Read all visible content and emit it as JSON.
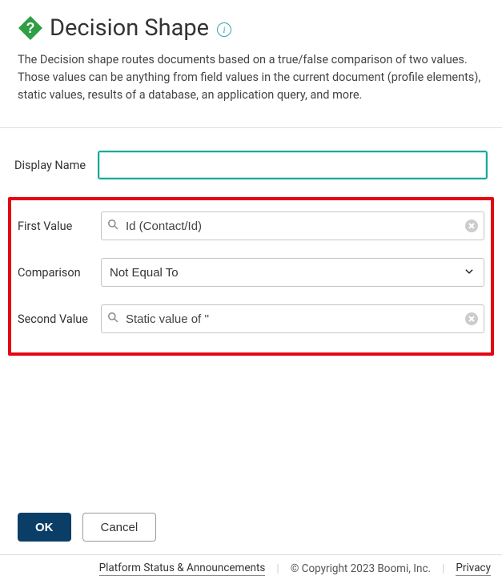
{
  "header": {
    "title": "Decision Shape",
    "description": "The Decision shape routes documents based on a true/false comparison of two values. Those values can be anything from field values in the current document (profile elements), static values, results of a database, an application query, and more."
  },
  "form": {
    "display_name": {
      "label": "Display Name",
      "value": ""
    },
    "first_value": {
      "label": "First Value",
      "value": "Id (Contact/Id)"
    },
    "comparison": {
      "label": "Comparison",
      "value": "Not Equal To"
    },
    "second_value": {
      "label": "Second Value",
      "value": "Static value of ''"
    }
  },
  "buttons": {
    "ok": "OK",
    "cancel": "Cancel"
  },
  "footer": {
    "status_link": "Platform Status & Announcements",
    "copyright": "© Copyright 2023 Boomi, Inc.",
    "privacy": "Privacy"
  }
}
